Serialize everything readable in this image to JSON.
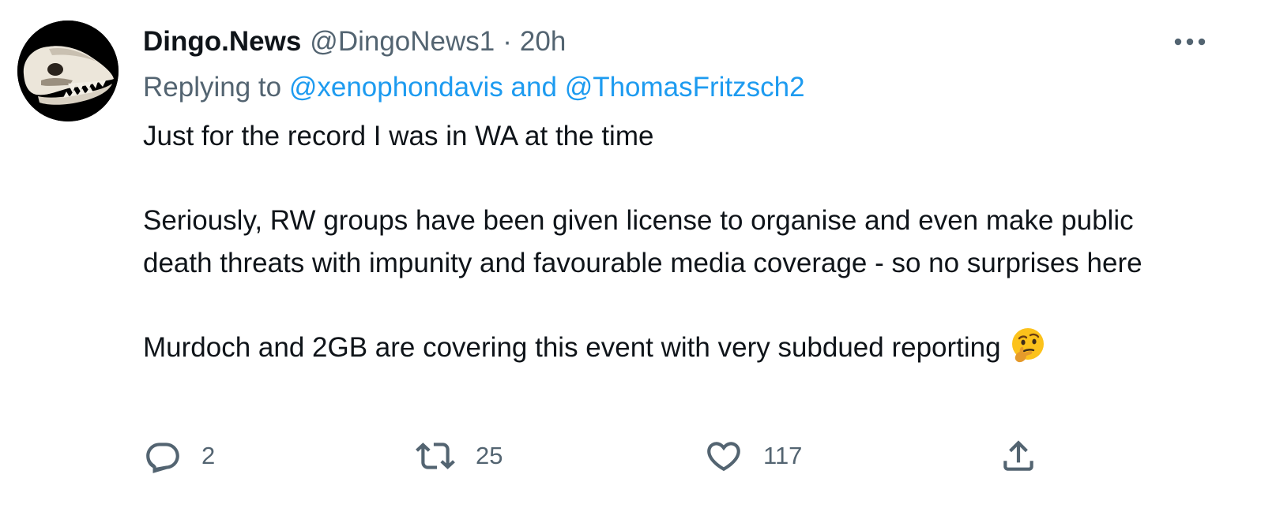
{
  "tweet": {
    "author": {
      "display_name": "Dingo.News",
      "handle": "@DingoNews1",
      "avatar_icon": "dingo-skull-avatar"
    },
    "separator": "·",
    "timestamp": "20h",
    "replying_to": {
      "prefix": "Replying to ",
      "mention1": "@xenophondavis",
      "conjunction": " and ",
      "mention2": "@ThomasFritzsch2"
    },
    "text": {
      "line1": "Just for the record I was in WA at the time",
      "paragraph2": "Seriously, RW groups have been given license to organise and even make public death threats with impunity and favourable media coverage - so no surprises here",
      "paragraph3": "Murdoch and 2GB are covering this event with very subdued reporting",
      "emoji": "thinking-face-emoji"
    },
    "actions": {
      "reply": {
        "icon": "reply-icon",
        "count": "2"
      },
      "retweet": {
        "icon": "retweet-icon",
        "count": "25"
      },
      "like": {
        "icon": "heart-icon",
        "count": "117"
      },
      "share": {
        "icon": "share-icon"
      }
    },
    "more_icon": "more-icon"
  },
  "colors": {
    "text_primary": "#0f1419",
    "text_secondary": "#536471",
    "link": "#1d9bf0",
    "background": "#ffffff"
  }
}
